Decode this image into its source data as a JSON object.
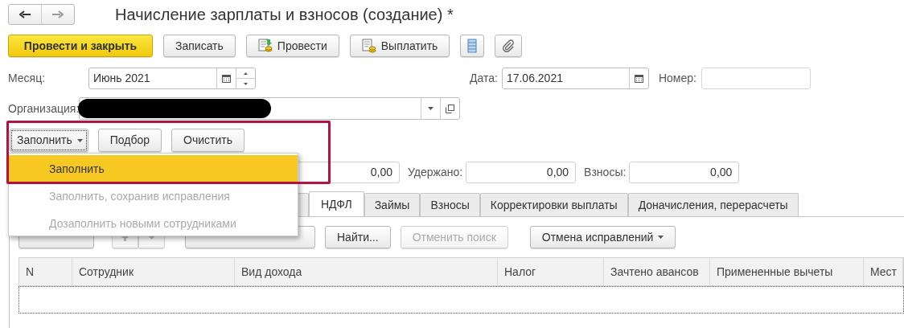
{
  "window": {
    "title": "Начисление зарплаты и взносов (создание) *"
  },
  "toolbar": [
    {
      "label": "Провести и закрыть",
      "kind": "primary"
    },
    {
      "label": "Записать",
      "kind": "plain"
    },
    {
      "label": "Провести",
      "kind": "post"
    },
    {
      "label": "Выплатить",
      "kind": "pay"
    },
    {
      "kind": "list"
    },
    {
      "kind": "attach"
    }
  ],
  "header_fields": {
    "month": {
      "label": "Месяц:",
      "value": "Июнь 2021"
    },
    "date": {
      "label": "Дата:",
      "value": "17.06.2021"
    },
    "number": {
      "label": "Номер:"
    },
    "organization": {
      "label": "Организация:"
    }
  },
  "fill_buttons": [
    {
      "label": "Заполнить",
      "kind": "dropdown"
    },
    {
      "label": "Подбор",
      "kind": "plain"
    },
    {
      "label": "Очистить",
      "kind": "plain"
    }
  ],
  "fill_menu": [
    {
      "label": "Заполнить",
      "selected": true,
      "disabled": false
    },
    {
      "label": "Заполнить, сохранив исправления",
      "selected": false,
      "disabled": true
    },
    {
      "label": "Дозаполнить новыми сотрудниками",
      "selected": false,
      "disabled": true
    }
  ],
  "totals": [
    {
      "value": "0,00"
    },
    {
      "label": "Удержано:",
      "value": "0,00"
    },
    {
      "label": "Взносы:",
      "value": "0,00"
    }
  ],
  "tabs": [
    {
      "label": "НДФЛ",
      "selected": true
    },
    {
      "label": "Займы",
      "selected": false
    },
    {
      "label": "Взносы",
      "selected": false
    },
    {
      "label": "Корректировки выплаты",
      "selected": false
    },
    {
      "label": "Доначисления, перерасчеты",
      "selected": false
    }
  ],
  "table_toolbar": [
    {
      "kind": "button",
      "disabled": false
    },
    {
      "kind": "move-up",
      "disabled": true
    },
    {
      "kind": "move-down",
      "disabled": true
    },
    {
      "kind": "button",
      "disabled": false
    },
    {
      "label": "Найти...",
      "kind": "button",
      "disabled": false
    },
    {
      "label": "Отменить поиск",
      "kind": "button",
      "disabled": true
    },
    {
      "label": "Отмена исправлений",
      "kind": "dropdown",
      "disabled": false
    }
  ],
  "table": {
    "columns": [
      "N",
      "Сотрудник",
      "Вид дохода",
      "Налог",
      "Зачтено авансов",
      "Примененные вычеты",
      "Мест"
    ]
  }
}
